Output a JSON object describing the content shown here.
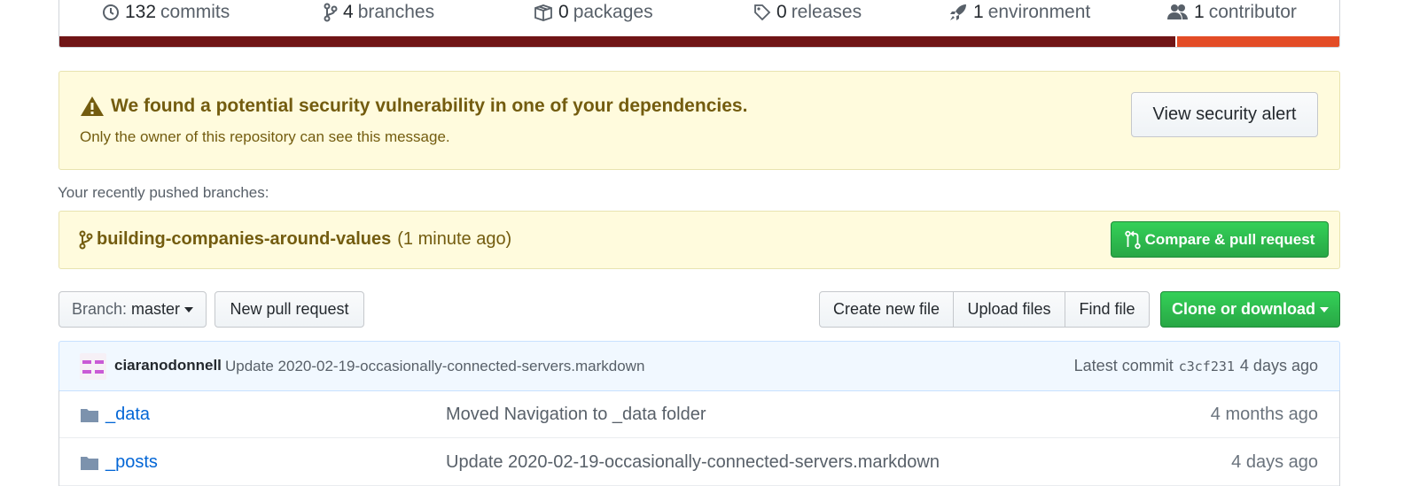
{
  "summary": {
    "commits": {
      "num": "132",
      "label": "commits",
      "icon": "history-icon"
    },
    "branches": {
      "num": "4",
      "label": "branches",
      "icon": "git-branch-icon"
    },
    "packages": {
      "num": "0",
      "label": "packages",
      "icon": "package-icon"
    },
    "releases": {
      "num": "0",
      "label": "releases",
      "icon": "tag-icon"
    },
    "environments": {
      "num": "1",
      "label": "environment",
      "icon": "rocket-icon"
    },
    "contributors": {
      "num": "1",
      "label": "contributor",
      "icon": "people-icon"
    },
    "language_bar": [
      {
        "color": "#701516",
        "share": 0.872
      },
      {
        "color": "#e34c26",
        "share": 0.128
      }
    ]
  },
  "security_alert": {
    "title": "We found a potential security vulnerability in one of your dependencies.",
    "subtitle": "Only the owner of this repository can see this message.",
    "button": "View security alert",
    "icon": "alert-icon"
  },
  "recent_branches": {
    "label": "Your recently pushed branches:",
    "branch": "building-companies-around-values",
    "time": "(1 minute ago)",
    "compare_button": "Compare & pull request"
  },
  "toolbar": {
    "branch_label": "Branch:",
    "branch_value": "master",
    "new_pr": "New pull request",
    "create_file": "Create new file",
    "upload_files": "Upload files",
    "find_file": "Find file",
    "clone": "Clone or download"
  },
  "latest_commit": {
    "author": "ciaranodonnell",
    "message": "Update 2020-02-19-occasionally-connected-servers.markdown",
    "label": "Latest commit",
    "sha": "c3cf231",
    "age": "4 days ago"
  },
  "files": [
    {
      "name": "_data",
      "message": "Moved Navigation to _data folder",
      "age": "4 months ago",
      "icon": "folder-icon"
    },
    {
      "name": "_posts",
      "message": "Update 2020-02-19-occasionally-connected-servers.markdown",
      "age": "4 days ago",
      "icon": "folder-icon"
    }
  ],
  "colors": {
    "alert_bg": "#fffbdd",
    "alert_text": "#735c0f",
    "link": "#0366d6",
    "green": "#28a745",
    "commit_bg": "#f1f8ff"
  }
}
